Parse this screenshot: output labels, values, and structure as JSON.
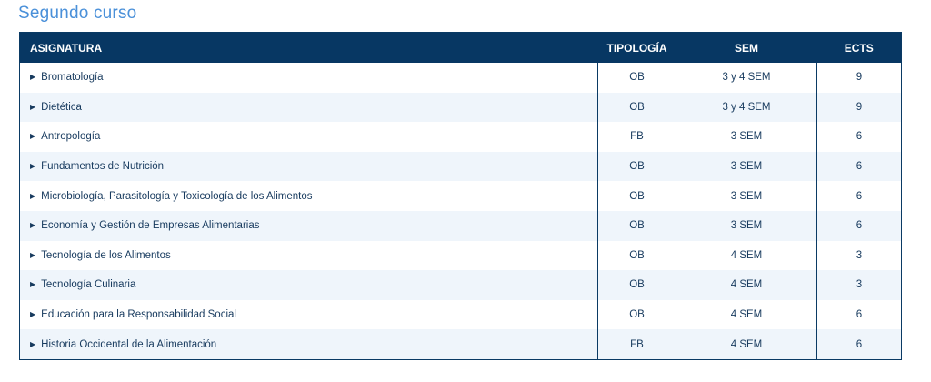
{
  "section": {
    "title": "Segundo curso"
  },
  "table": {
    "headers": [
      "ASIGNATURA",
      "TIPOLOGÍA",
      "SEM",
      "ECTS"
    ],
    "rows": [
      {
        "name": "Bromatología",
        "tipologia": "OB",
        "sem": "3 y 4 SEM",
        "ects": "9"
      },
      {
        "name": "Dietética",
        "tipologia": "OB",
        "sem": "3 y 4 SEM",
        "ects": "9"
      },
      {
        "name": "Antropología",
        "tipologia": "FB",
        "sem": "3 SEM",
        "ects": "6"
      },
      {
        "name": "Fundamentos de Nutrición",
        "tipologia": "OB",
        "sem": "3 SEM",
        "ects": "6"
      },
      {
        "name": "Microbiología, Parasitología y Toxicología de los Alimentos",
        "tipologia": "OB",
        "sem": "3 SEM",
        "ects": "6"
      },
      {
        "name": "Economía y Gestión de Empresas Alimentarias",
        "tipologia": "OB",
        "sem": "3 SEM",
        "ects": "6"
      },
      {
        "name": "Tecnología de los Alimentos",
        "tipologia": "OB",
        "sem": "4 SEM",
        "ects": "3"
      },
      {
        "name": "Tecnología Culinaria",
        "tipologia": "OB",
        "sem": "4 SEM",
        "ects": "3"
      },
      {
        "name": "Educación para la Responsabilidad Social",
        "tipologia": "OB",
        "sem": "4 SEM",
        "ects": "6"
      },
      {
        "name": "Historia Occidental de la Alimentación",
        "tipologia": "FB",
        "sem": "4 SEM",
        "ects": "6"
      }
    ]
  },
  "icons": {
    "row_toggle": "triangle-right-icon"
  },
  "colors": {
    "header_bg": "#073763",
    "title": "#4a90d9",
    "row_alt": "#eff5fb"
  }
}
